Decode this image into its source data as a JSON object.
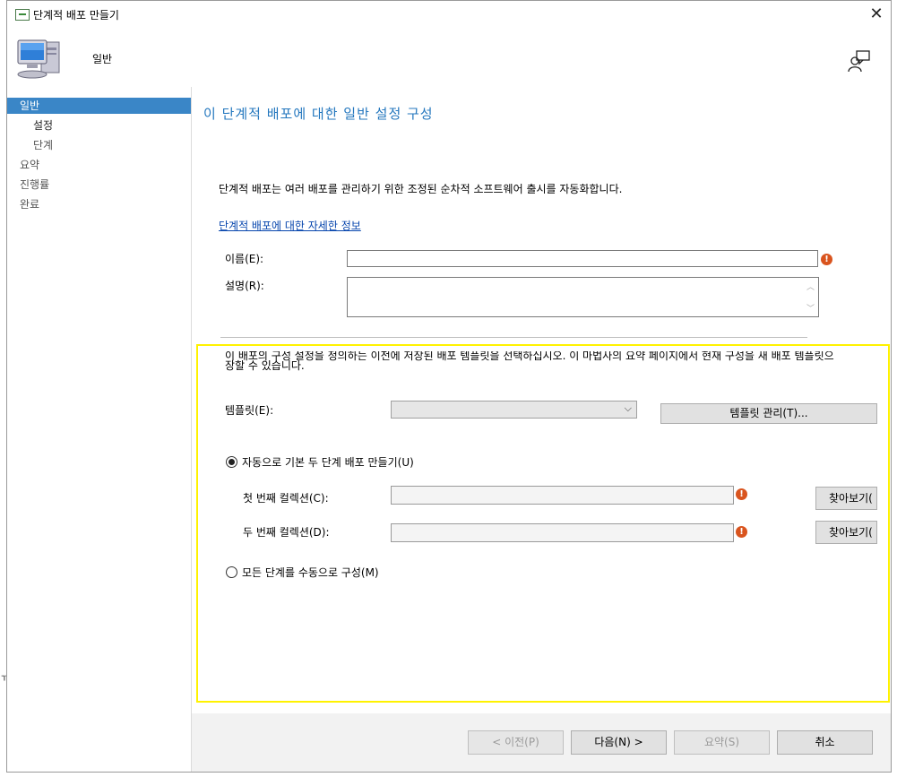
{
  "window": {
    "title": "단계적 배포 만들기"
  },
  "header": {
    "title": "일반"
  },
  "nav": {
    "items": [
      {
        "label": "일반"
      },
      {
        "label": "설정"
      },
      {
        "label": "단계"
      },
      {
        "label": "요약"
      },
      {
        "label": "진행률"
      },
      {
        "label": "완료"
      }
    ]
  },
  "page": {
    "heading": "이 단계적 배포에 대한 일반 설정 구성",
    "description": "단계적 배포는 여러 배포를 관리하기 위한 조정된 순차적 소프트웨어 출시를 자동화합니다.",
    "more_info_link": "단계적 배포에 대한 자세한 정보",
    "name_label": "이름(E):",
    "name_value": "",
    "description_label": "설명(R):",
    "description_value": "",
    "template_info": "이 배포의 구성 설정을 정의하는 이전에 저장된 배포 템플릿을 선택하십시오. 이 마법사의 요약 페이지에서 현재 구성을 새 배포 템플릿으",
    "template_info_line2": "장할 수 있습니다.",
    "template_label": "템플릿(E):",
    "template_value": "",
    "manage_templates_button": "템플릿 관리(T)...",
    "auto_option_label": "자동으로 기본 두 단계 배포 만들기(U)",
    "first_collection_label": "첫 번째 컬렉션(C):",
    "first_collection_value": "",
    "second_collection_label": "두 번째 컬렉션(D):",
    "second_collection_value": "",
    "browse_button": "찾아보기(",
    "manual_option_label": "모든 단계를 수동으로 구성(M)"
  },
  "footer": {
    "prev": "< 이전(P)",
    "next": "다음(N) >",
    "summary": "요약(S)",
    "cancel": "취소"
  },
  "icons": {
    "title": "wizard-window-icon",
    "header": "computer-icon",
    "help": "user-feedback-icon",
    "error": "error-icon",
    "close": "close-icon"
  },
  "colors": {
    "accent": "#3a86c7",
    "heading": "#2477be",
    "highlight_box": "#fff200",
    "error": "#d9541e"
  }
}
